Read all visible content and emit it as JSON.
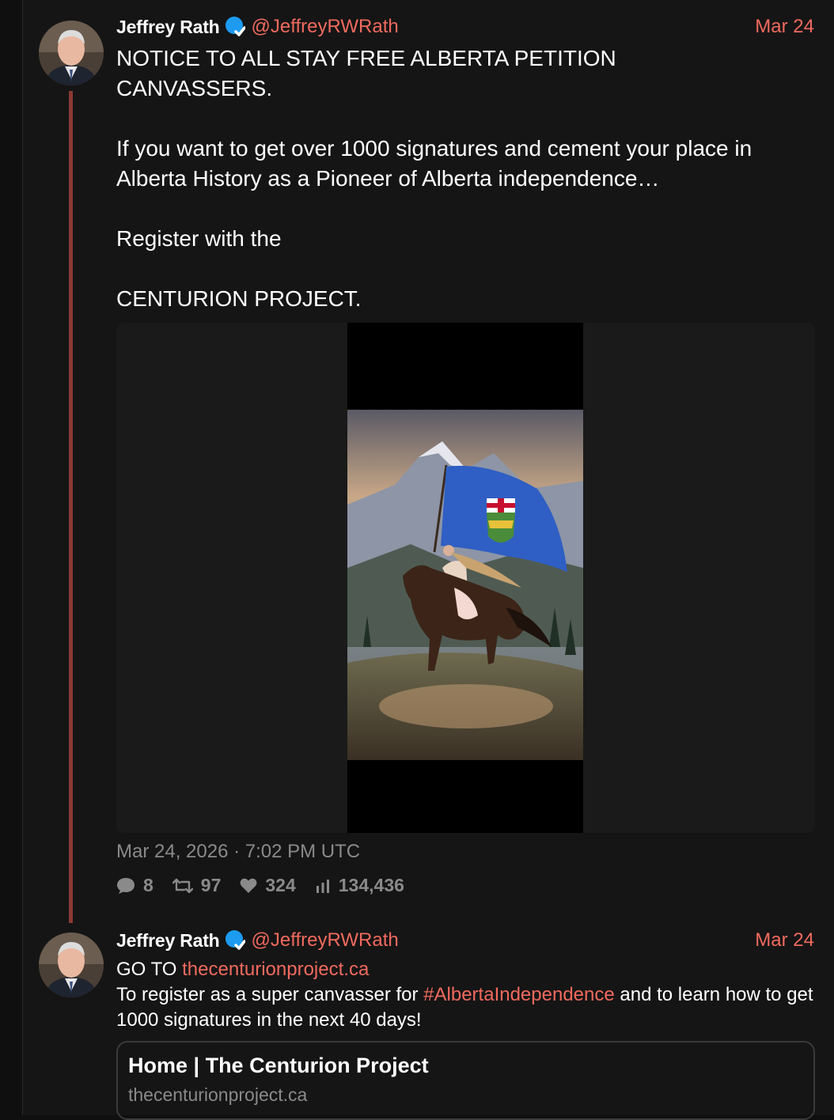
{
  "tweets": [
    {
      "author_name": "Jeffrey Rath",
      "handle": "@JeffreyRWRath",
      "date": "Mar 24",
      "text": "NOTICE TO ALL STAY FREE ALBERTA PETITION\nCANVASSERS.\n\nIf you want to get over 1000 signatures and cement your place in Alberta History as a Pioneer of Alberta independence…\n\nRegister with the\n\nCENTURION PROJECT.",
      "timestamp": "Mar 24, 2026 · 7:02 PM UTC",
      "stats": {
        "replies": "8",
        "retweets": "97",
        "likes": "324",
        "views": "134,436"
      }
    },
    {
      "author_name": "Jeffrey Rath",
      "handle": "@JeffreyRWRath",
      "date": "Mar 24",
      "line1_prefix": "GO TO ",
      "line1_link": "thecenturionproject.ca",
      "line2_prefix": "To register as a super canvasser for ",
      "line2_hashtag": "#AlbertaIndependence",
      "line2_suffix": " and to learn how to get 1000 signatures in the next 40 days!",
      "card": {
        "title": "Home | The Centurion Project",
        "domain": "thecenturionproject.ca"
      }
    }
  ],
  "colors": {
    "accent": "#f06a5e",
    "verified": "#1d9bf0",
    "thread_line": "#8a3a34",
    "muted": "#8a8a8a"
  }
}
